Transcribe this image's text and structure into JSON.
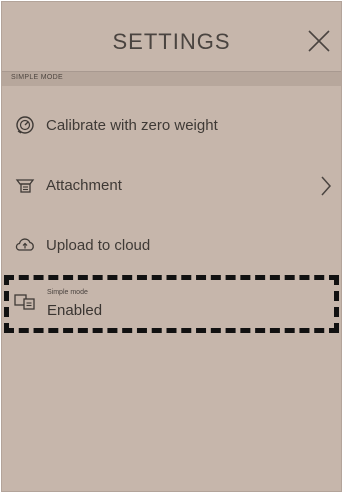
{
  "header": {
    "title": "SETTINGS",
    "close_icon": "close-icon"
  },
  "section": {
    "label": "SIMPLE MODE"
  },
  "items": [
    {
      "label": "Calibrate with zero weight",
      "icon": "scale-icon"
    },
    {
      "label": "Attachment",
      "icon": "attachment-icon",
      "has_chevron": true
    },
    {
      "label": "Upload to cloud",
      "icon": "cloud-upload-icon"
    }
  ],
  "simple_mode": {
    "caption": "Simple mode",
    "value": "Enabled",
    "icon": "simple-mode-icon"
  }
}
